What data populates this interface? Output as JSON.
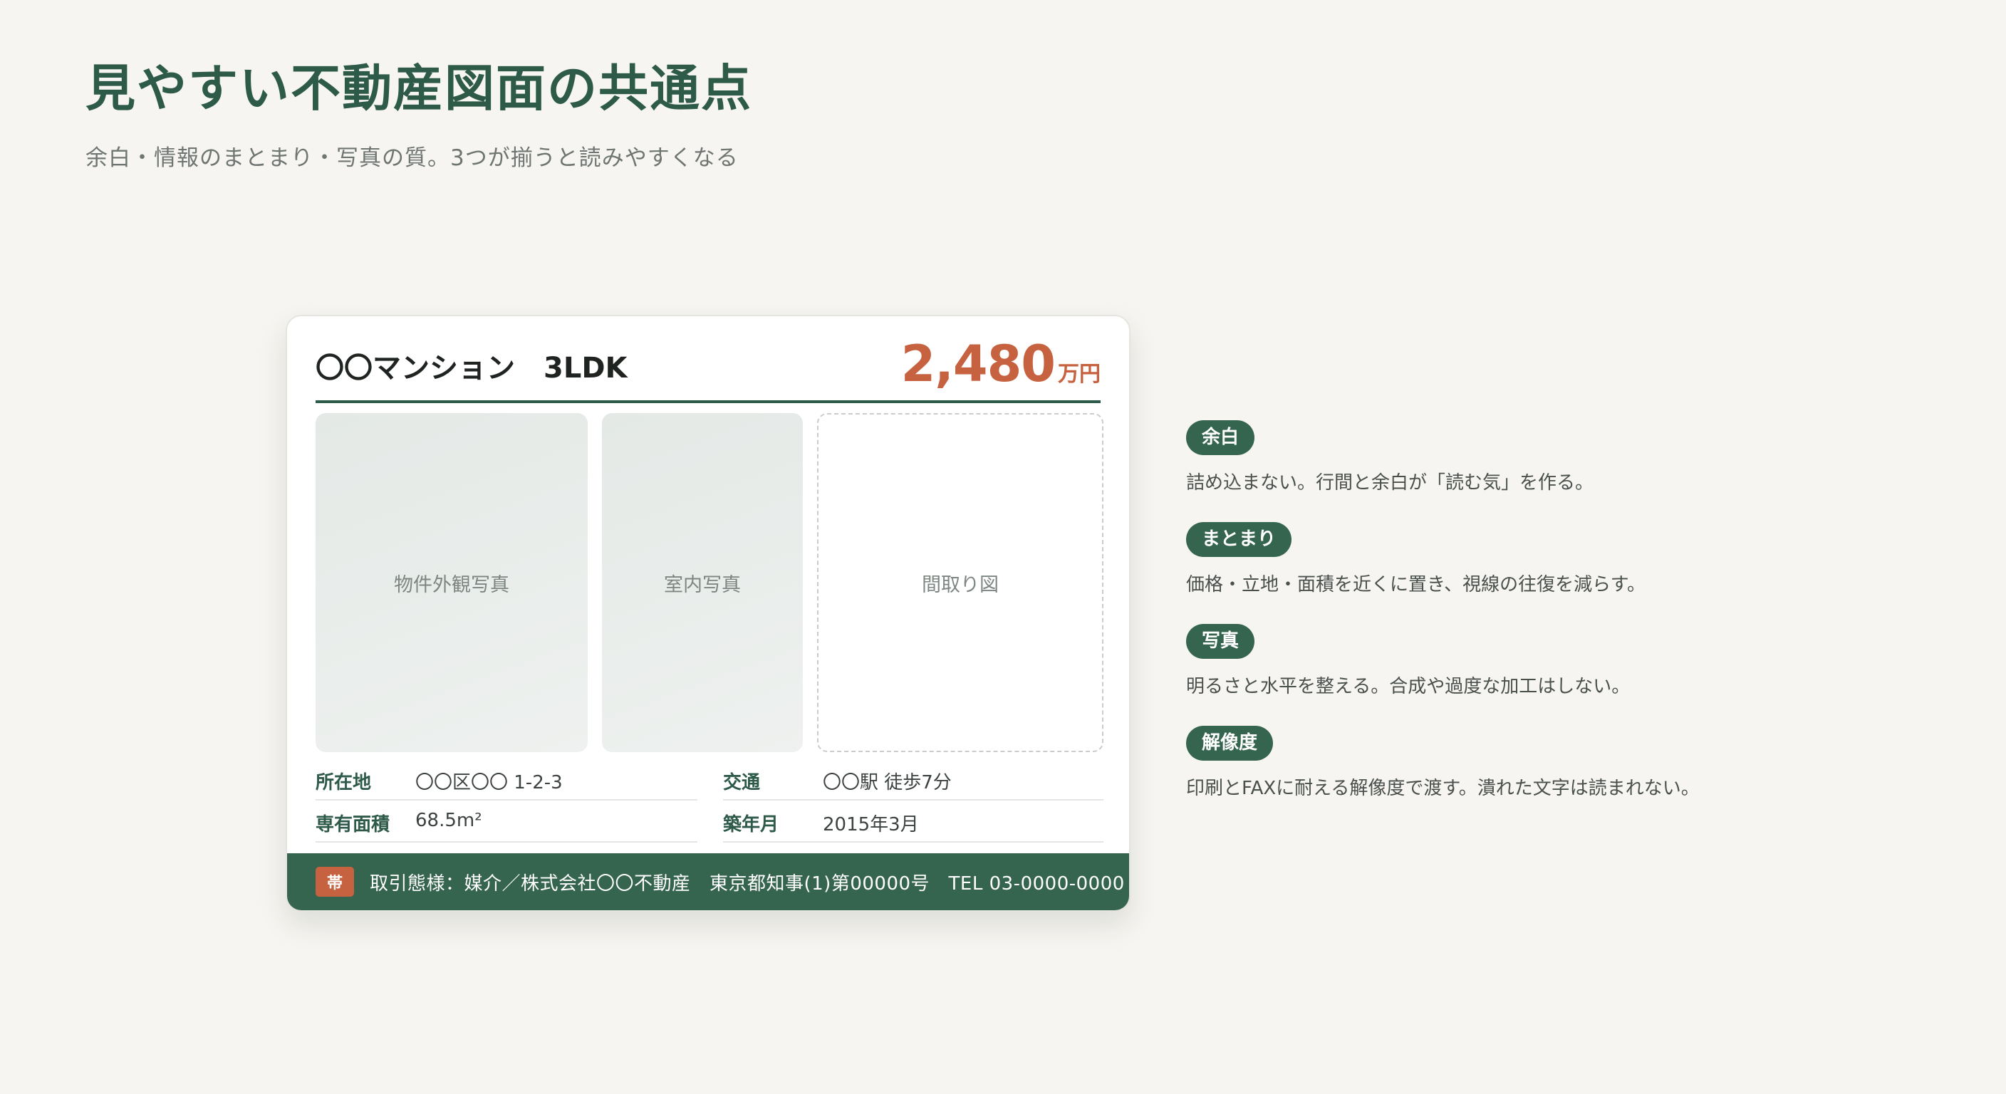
{
  "page": {
    "title": "見やすい不動産図面の共通点",
    "subtitle": "余白・情報のまとまり・写真の質。3つが揃うと読みやすくなる"
  },
  "flyer": {
    "property_name": "〇〇マンション　3LDK",
    "price_value": "2,480",
    "price_unit": "万円",
    "photos": {
      "exterior": "物件外観写真",
      "interior": "室内写真",
      "floorplan": "間取り図"
    },
    "info": {
      "address_label": "所在地",
      "address_value": "〇〇区〇〇 1-2-3",
      "access_label": "交通",
      "access_value": "〇〇駅 徒歩7分",
      "area_label": "専有面積",
      "area_value": "68.5m²",
      "built_label": "築年月",
      "built_value": "2015年3月"
    },
    "band": {
      "badge": "帯",
      "text": "取引態様：媒介／株式会社〇〇不動産　東京都知事(1)第00000号　TEL 03-0000-0000"
    }
  },
  "points": [
    {
      "tag": "余白",
      "desc": "詰め込まない。行間と余白が「読む気」を作る。"
    },
    {
      "tag": "まとまり",
      "desc": "価格・立地・面積を近くに置き、視線の往復を減らす。"
    },
    {
      "tag": "写真",
      "desc": "明るさと水平を整える。合成や過度な加工はしない。"
    },
    {
      "tag": "解像度",
      "desc": "印刷とFAXに耐える解像度で渡す。潰れた文字は読まれない。"
    }
  ],
  "colors": {
    "background": "#f6f5f1",
    "accent_green": "#2e5a49",
    "band_green": "#35644f",
    "price_orange": "#c6623f"
  }
}
